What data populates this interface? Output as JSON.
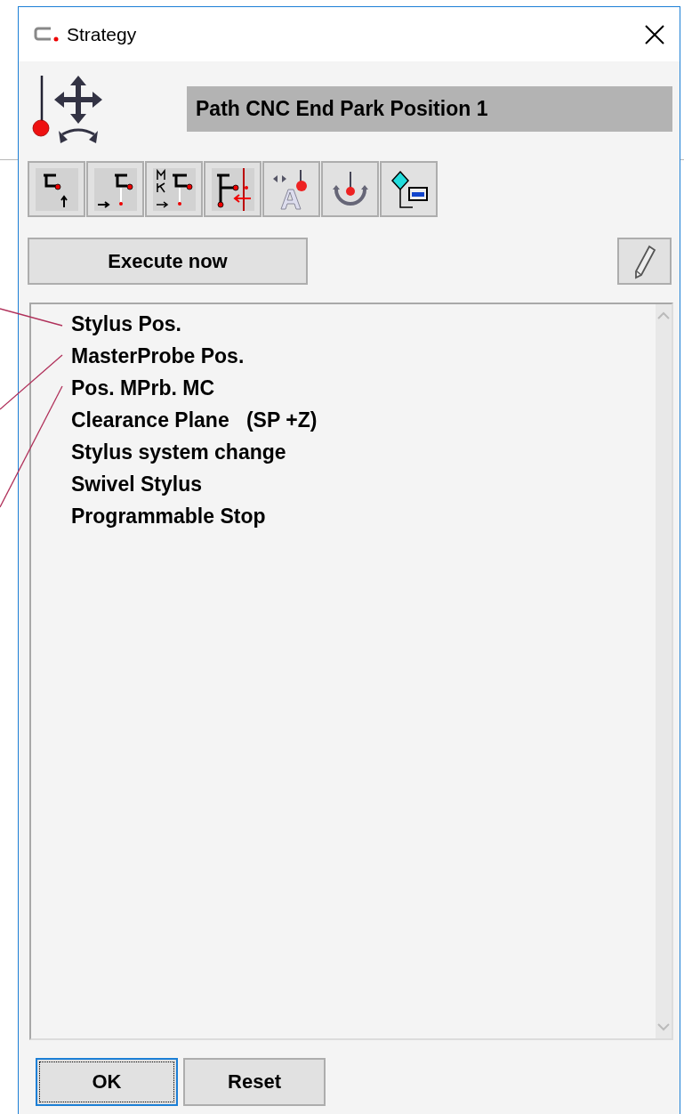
{
  "window": {
    "title": "Strategy"
  },
  "header": {
    "value": "Path CNC End Park Position 1"
  },
  "execute_button": {
    "label": "Execute now"
  },
  "list": {
    "items": [
      {
        "label": "Stylus Pos."
      },
      {
        "label": "MasterProbe Pos."
      },
      {
        "label": "Pos. MPrb. MC"
      },
      {
        "label": "Clearance Plane   (SP +Z)"
      },
      {
        "label": "Stylus system change"
      },
      {
        "label": "Swivel Stylus"
      },
      {
        "label": "Programmable Stop"
      }
    ]
  },
  "buttons": [
    {
      "label": "OK",
      "focused": true
    },
    {
      "label": "Reset",
      "focused": false
    }
  ]
}
